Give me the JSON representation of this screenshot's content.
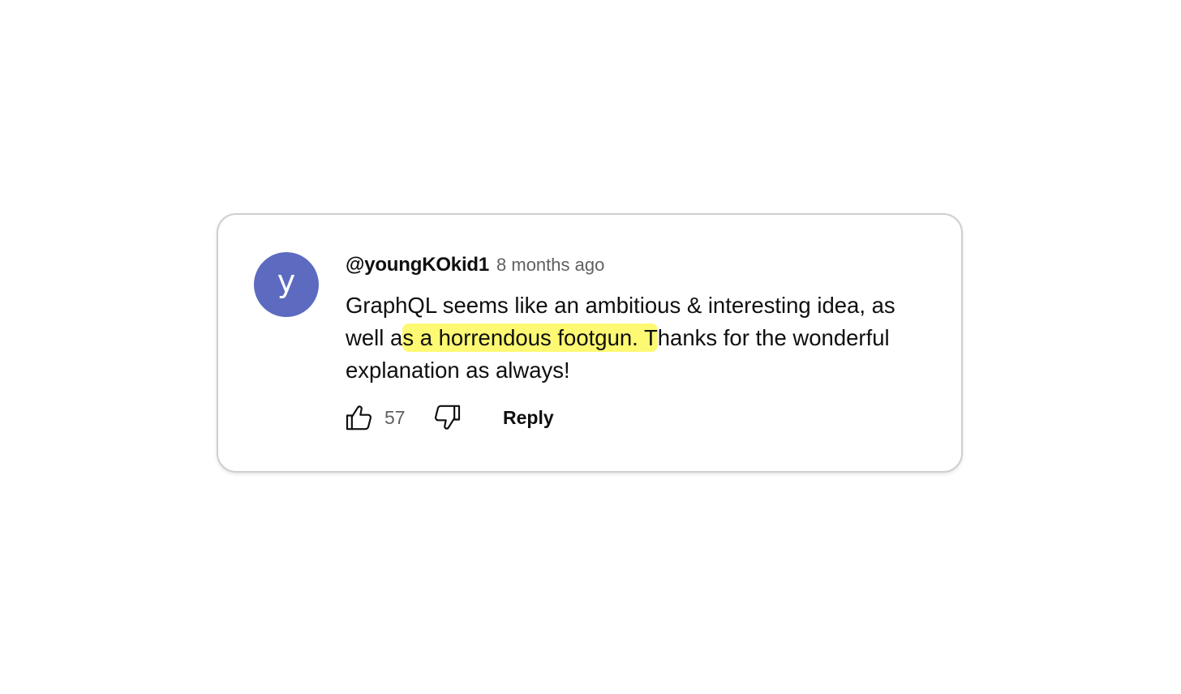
{
  "comment": {
    "avatar_letter": "y",
    "avatar_color": "#5c6bc0",
    "author": "@youngKOkid1",
    "timestamp": "8 months ago",
    "text_before": "GraphQL seems like an ambitious & interesting idea, as well a",
    "text_highlight": "s a horrendous footgun. T",
    "text_after": "hanks for the wonderful explanation as always!",
    "highlight_color": "#fef972"
  },
  "actions": {
    "like_icon": "thumbs-up-icon",
    "like_count": "57",
    "dislike_icon": "thumbs-down-icon",
    "reply_label": "Reply"
  }
}
